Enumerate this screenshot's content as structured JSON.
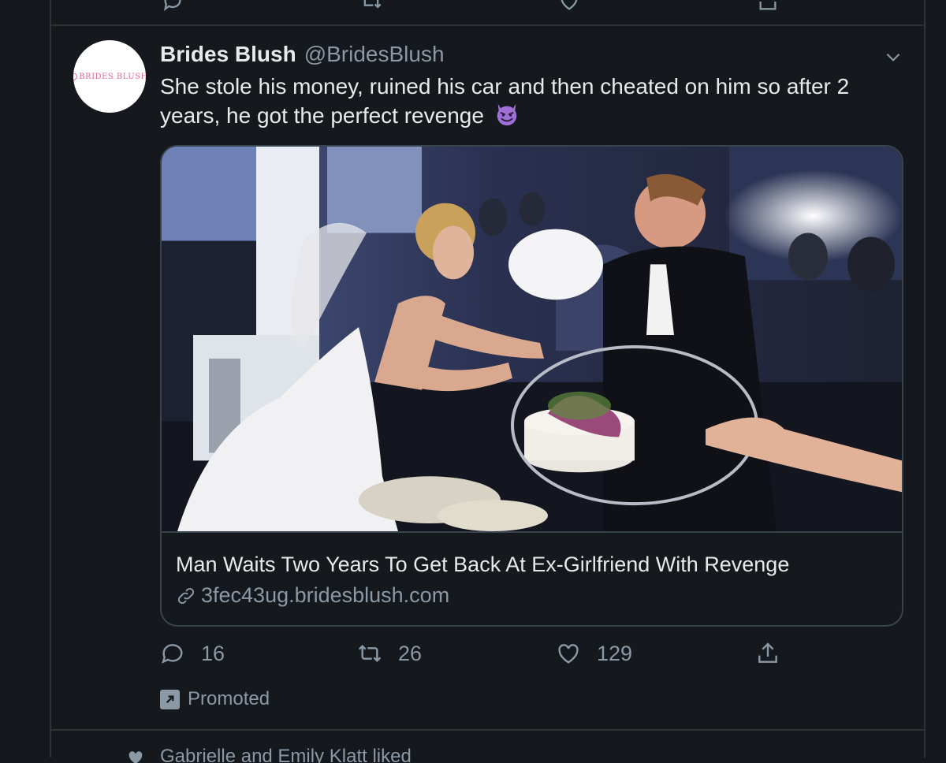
{
  "tweet": {
    "display_name": "Brides Blush",
    "handle": "@BridesBlush",
    "avatar_text": "BRIDES BLUSH",
    "text": "She stole his money, ruined his car and then cheated on him so after 2 years, he got the perfect revenge",
    "emoji": "smiling-face-with-horns",
    "card": {
      "title": "Man Waits Two Years To Get Back At Ex-Girlfriend With Revenge",
      "domain": "3fec43ug.bridesblush.com"
    },
    "actions": {
      "replies": "16",
      "retweets": "26",
      "likes": "129"
    },
    "promoted_label": "Promoted"
  },
  "next_tweet": {
    "social_context": "Gabrielle and Emily Klatt liked"
  },
  "colors": {
    "background": "#15181c",
    "border": "#2f3336",
    "text_primary": "#e7e9ea",
    "text_secondary": "#8b98a5",
    "avatar_logo": "#e36a8c",
    "emoji": "#a06fd6"
  }
}
